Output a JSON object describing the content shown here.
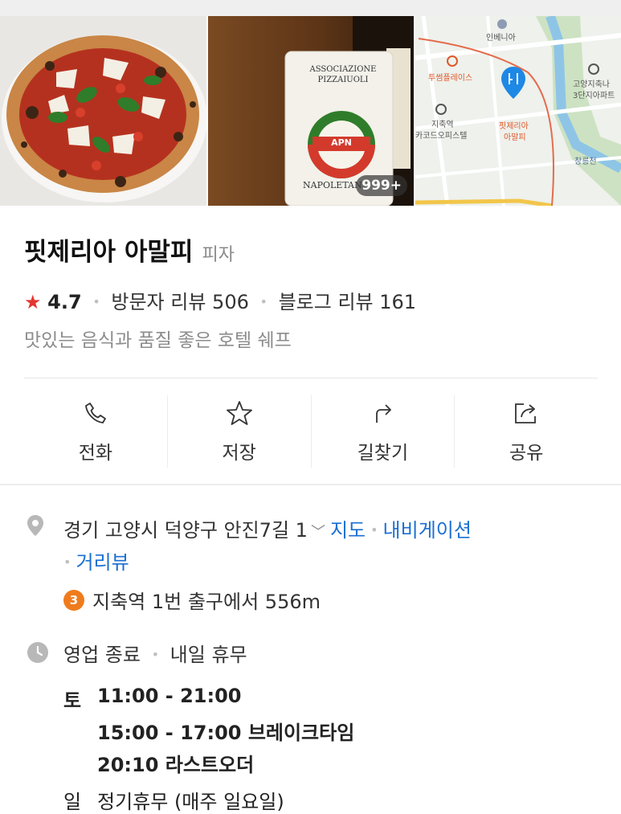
{
  "photos": {
    "badge_text": "APN",
    "card_title": "ASSOCIAZIONE PIZZAIUOLI",
    "card_footer": "NAPOLETAN",
    "photo_count": "999+",
    "map_labels": {
      "inbenia": "인베니아",
      "twosome": "투썸플레이스",
      "station_line1": "지축역",
      "station_line2": "카코드오피스텔",
      "apt_line1": "고양지축나",
      "apt_line2": "3단지아파트",
      "place_line1": "핏제리아",
      "place_line2": "아말피",
      "stream": "창릉천"
    }
  },
  "header": {
    "name": "핏제리아 아말피",
    "category": "피자",
    "rating": "4.7",
    "visitor_reviews": "방문자 리뷰 506",
    "blog_reviews": "블로그 리뷰 161",
    "description": "맛있는 음식과 품질 좋은 호텔 쉐프"
  },
  "actions": [
    {
      "label": "전화",
      "icon": "phone-icon"
    },
    {
      "label": "저장",
      "icon": "star-icon"
    },
    {
      "label": "길찾기",
      "icon": "directions-icon"
    },
    {
      "label": "공유",
      "icon": "share-icon"
    }
  ],
  "address": {
    "text": "경기 고양시 덕양구 안진7길 1",
    "map_link": "지도",
    "navigation_link": "내비게이션",
    "streetview_link": "거리뷰"
  },
  "subway": {
    "line": "3",
    "text": "지축역 1번 출구에서 556m",
    "line_color": "#ef7c1c"
  },
  "business": {
    "status": "영업 종료",
    "next": "내일 휴무",
    "hours": [
      {
        "day": "토",
        "slots": [
          "11:00 - 21:00",
          "15:00 - 17:00 브레이크타임",
          "20:10 라스트오더"
        ]
      }
    ],
    "sunday_day": "일",
    "sunday_text": "정기휴무 (매주 일요일)"
  },
  "colors": {
    "accent_link": "#1a6fd1",
    "rating_star": "#e2362f",
    "map_pin": "#1e88e5"
  }
}
